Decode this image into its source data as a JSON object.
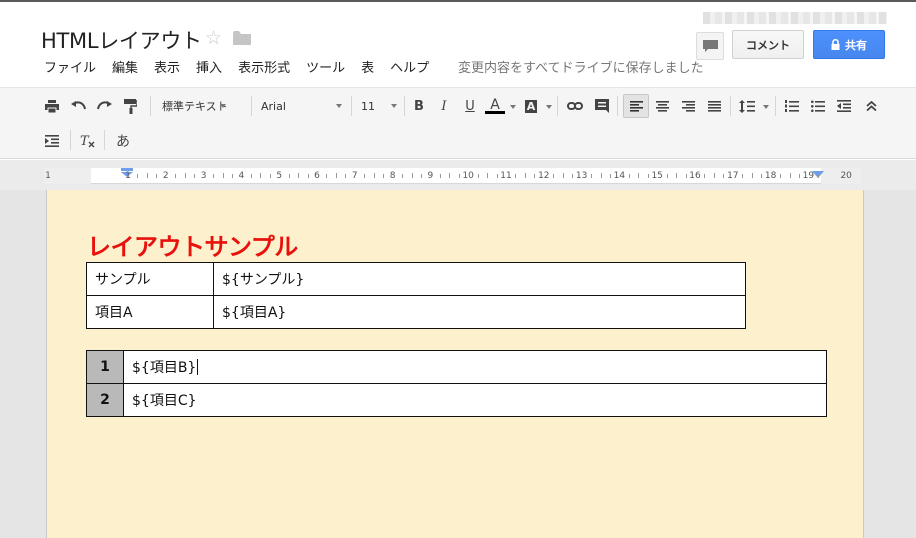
{
  "header": {
    "title": "HTMLレイアウト",
    "comment_label": "コメント",
    "share_label": "共有",
    "save_status": "変更内容をすべてドライブに保存しました"
  },
  "menu": [
    "ファイル",
    "編集",
    "表示",
    "挿入",
    "表示形式",
    "ツール",
    "表",
    "ヘルプ"
  ],
  "toolbar": {
    "style_value": "標準テキスト",
    "font_value": "Arial",
    "size_value": "11",
    "bold": "B",
    "italic": "I",
    "underline": "U",
    "text_color": "A",
    "highlight": "A",
    "input_tool": "あ",
    "text_color_swatch": "#000000"
  },
  "ruler": {
    "numbers": [
      "1",
      "1",
      "2",
      "3",
      "4",
      "5",
      "6",
      "7",
      "8",
      "9",
      "10",
      "11",
      "12",
      "13",
      "14",
      "15",
      "16",
      "17",
      "18",
      "19",
      "20"
    ]
  },
  "document": {
    "heading": "レイアウトサンプル",
    "heading_color": "#e8120c",
    "page_color": "#fdf0cc",
    "table1": {
      "rows": [
        [
          "サンプル",
          "${サンプル}"
        ],
        [
          "項目A",
          "${項目A}"
        ]
      ]
    },
    "table2": {
      "rows": [
        [
          "1",
          "${項目B}"
        ],
        [
          "2",
          "${項目C}"
        ]
      ]
    }
  }
}
